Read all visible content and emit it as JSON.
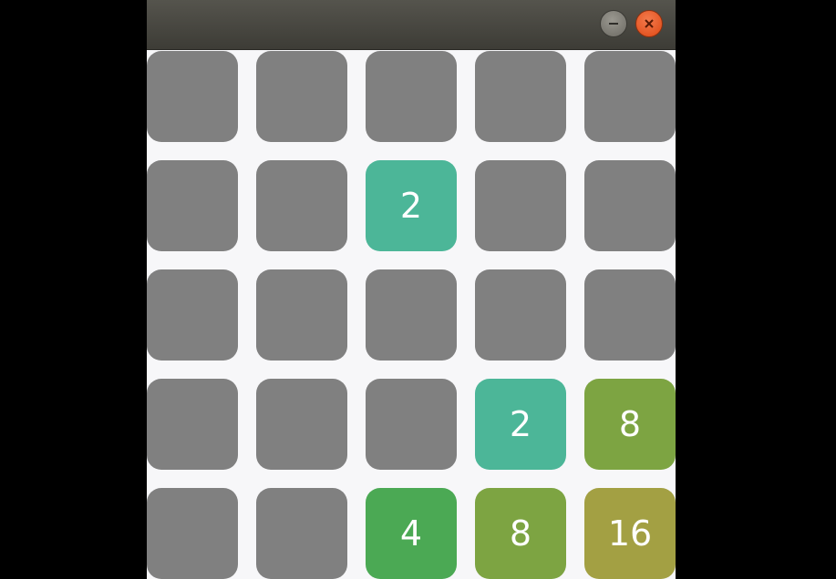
{
  "window": {
    "buttons": {
      "minimize_icon": "minus-icon",
      "close_icon": "close-icon"
    }
  },
  "board": {
    "rows": 5,
    "cols": 5,
    "cells": [
      [
        "",
        "",
        "",
        "",
        ""
      ],
      [
        "",
        "",
        "2",
        "",
        ""
      ],
      [
        "",
        "",
        "",
        "",
        ""
      ],
      [
        "",
        "",
        "",
        "2",
        "8"
      ],
      [
        "",
        "",
        "4",
        "8",
        "16"
      ]
    ]
  },
  "colors": {
    "empty": "#808080",
    "2": "#4cb698",
    "4": "#4ba954",
    "8": "#7da442",
    "16": "#a3a043",
    "background": "#f7f7f9",
    "minimize": "#7b7a73",
    "close": "#e95420"
  }
}
